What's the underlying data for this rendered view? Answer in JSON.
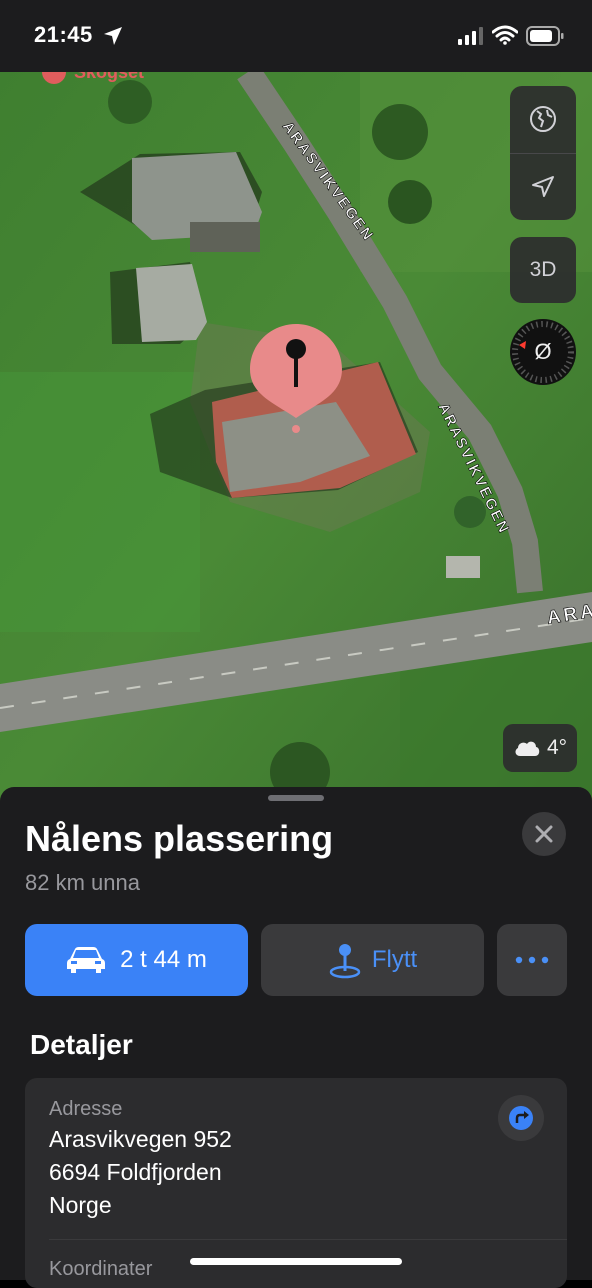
{
  "status_bar": {
    "time": "21:45"
  },
  "map": {
    "poi_label": "Skogset",
    "road_labels": [
      "ARASVIKVEGEN",
      "ARASVIKVEGEN",
      "ARA"
    ],
    "weather": {
      "icon": "cloud-icon",
      "temperature": "4°"
    },
    "controls": {
      "three_d_label": "3D",
      "compass_label": "Ø"
    }
  },
  "sheet": {
    "title": "Nålens plassering",
    "distance": "82 km unna",
    "actions": {
      "directions_label": "2 t 44 m",
      "move_label": "Flytt"
    },
    "details_heading": "Detaljer",
    "address": {
      "label": "Adresse",
      "line1": "Arasvikvegen 952",
      "line2": "6694 Foldfjorden",
      "line3": "Norge"
    },
    "coordinates_label": "Koordinater"
  },
  "colors": {
    "accent": "#3a82f7",
    "pin": "#e88a8a"
  }
}
